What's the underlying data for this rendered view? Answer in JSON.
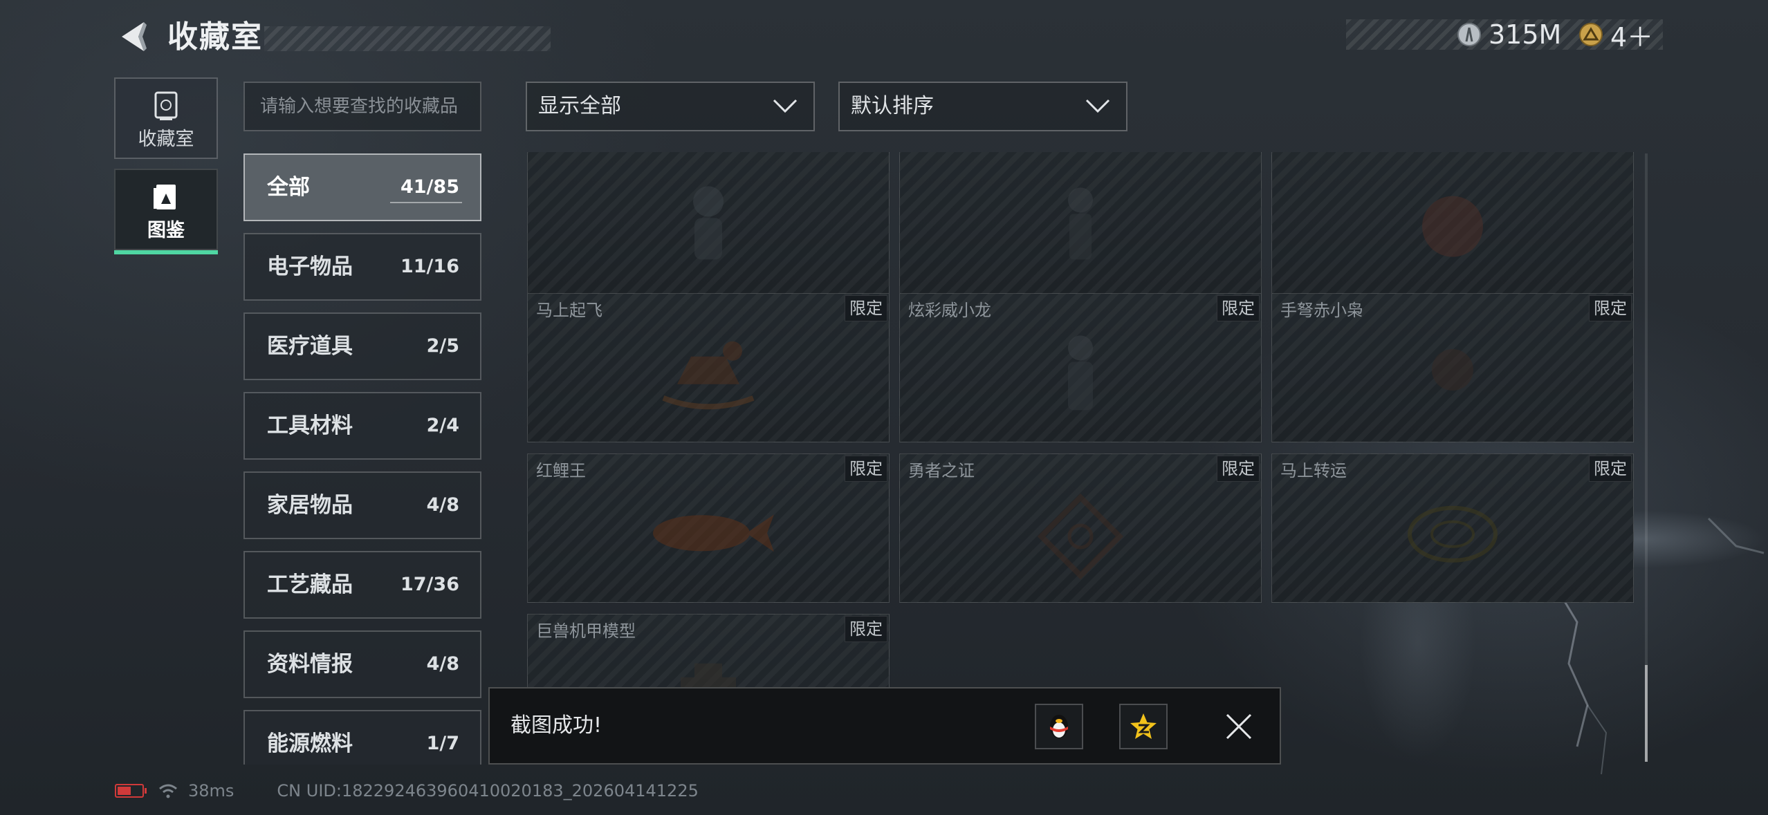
{
  "header": {
    "title": "收藏室"
  },
  "currencies": {
    "silver": "315M",
    "gold": "4＋"
  },
  "rail": {
    "collection_label": "收藏室",
    "codex_label": "图鉴"
  },
  "search": {
    "placeholder": "请输入想要查找的收藏品"
  },
  "filters": {
    "filter_value": "显示全部",
    "sort_value": "默认排序"
  },
  "categories": [
    {
      "name": "全部",
      "count": "41/85"
    },
    {
      "name": "电子物品",
      "count": "11/16"
    },
    {
      "name": "医疗道具",
      "count": "2/5"
    },
    {
      "name": "工具材料",
      "count": "2/4"
    },
    {
      "name": "家居物品",
      "count": "4/8"
    },
    {
      "name": "工艺藏品",
      "count": "17/36"
    },
    {
      "name": "资料情报",
      "count": "4/8"
    },
    {
      "name": "能源燃料",
      "count": "1/7"
    }
  ],
  "items": [
    {
      "name": "",
      "tag": ""
    },
    {
      "name": "",
      "tag": ""
    },
    {
      "name": "",
      "tag": ""
    },
    {
      "name": "马上起飞",
      "tag": "限定"
    },
    {
      "name": "炫彩威小龙",
      "tag": "限定"
    },
    {
      "name": "手弩赤小枭",
      "tag": "限定"
    },
    {
      "name": "红鲤王",
      "tag": "限定"
    },
    {
      "name": "勇者之证",
      "tag": "限定"
    },
    {
      "name": "马上转运",
      "tag": "限定"
    },
    {
      "name": "巨兽机甲模型",
      "tag": "限定"
    }
  ],
  "toast": {
    "message": "截图成功!"
  },
  "status": {
    "ping": "38ms",
    "uid": "CN UID:18229246396041002018​3_202604141225"
  },
  "colors": {
    "accent": "#4fd6a2",
    "battery_low": "#d13a3a"
  },
  "battery_level": 0.55
}
